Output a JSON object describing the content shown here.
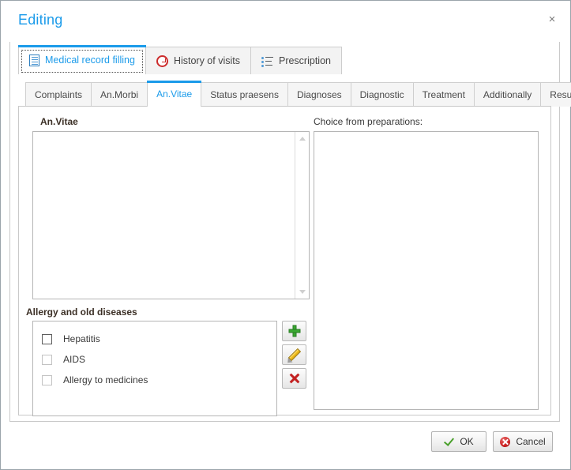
{
  "window": {
    "title": "Editing",
    "close_label": "×",
    "accent_color": "#1b9bea"
  },
  "top_tabs": [
    {
      "label": "Medical record filling",
      "icon": "document-icon",
      "active": true
    },
    {
      "label": "History of visits",
      "icon": "clock-icon",
      "active": false
    },
    {
      "label": "Prescription",
      "icon": "list-icon",
      "active": false
    }
  ],
  "sub_tabs": [
    {
      "label": "Complaints",
      "active": false
    },
    {
      "label": "An.Morbi",
      "active": false
    },
    {
      "label": "An.Vitae",
      "active": true
    },
    {
      "label": "Status praesens",
      "active": false
    },
    {
      "label": "Diagnoses",
      "active": false
    },
    {
      "label": "Diagnostic",
      "active": false
    },
    {
      "label": "Treatment",
      "active": false
    },
    {
      "label": "Additionally",
      "active": false
    },
    {
      "label": "Result",
      "active": false
    }
  ],
  "left_panel": {
    "anvitae_label": "An.Vitae",
    "anvitae_value": "",
    "allergy_label": "Allergy and old diseases",
    "allergy_items": [
      {
        "label": "Hepatitis",
        "checked": false
      },
      {
        "label": "AIDS",
        "checked": false
      },
      {
        "label": "Allergy to medicines",
        "checked": false
      }
    ],
    "side_buttons": [
      {
        "name": "add-button",
        "icon": "plus-icon"
      },
      {
        "name": "edit-button",
        "icon": "pencil-icon"
      },
      {
        "name": "delete-button",
        "icon": "delete-x-icon"
      }
    ]
  },
  "right_panel": {
    "preparations_label": "Choice from preparations:",
    "preparations_value": ""
  },
  "footer": {
    "ok_label": "OK",
    "cancel_label": "Cancel"
  }
}
